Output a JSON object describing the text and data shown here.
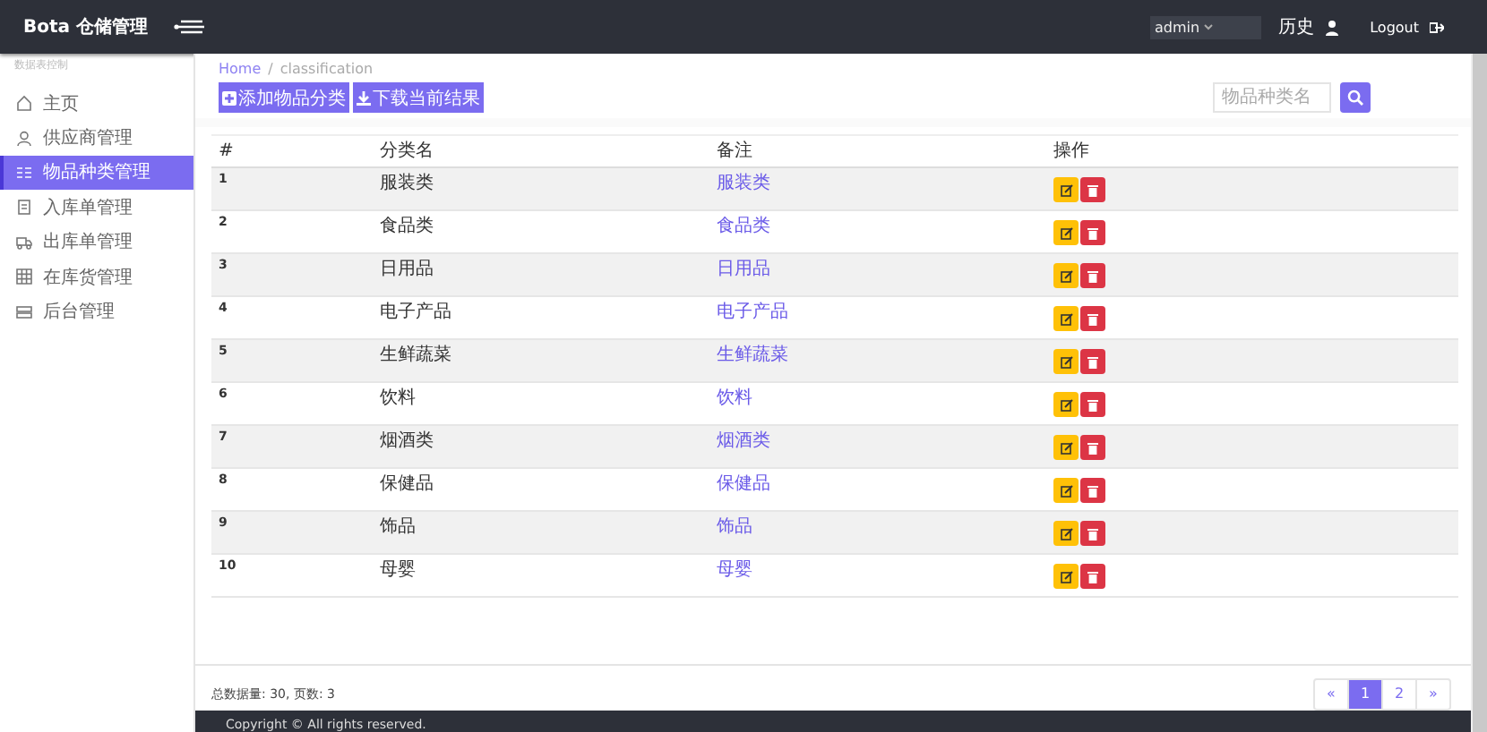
{
  "header": {
    "brand": "Bota 仓储管理",
    "user": "admin",
    "history": "历史",
    "logout": "Logout"
  },
  "sidebar": {
    "heading": "数据表控制",
    "items": [
      {
        "label": "主页",
        "selected": false
      },
      {
        "label": "供应商管理",
        "selected": false
      },
      {
        "label": "物品种类管理",
        "selected": true
      },
      {
        "label": "入库单管理",
        "selected": false
      },
      {
        "label": "出库单管理",
        "selected": false
      },
      {
        "label": "在库货管理",
        "selected": false
      },
      {
        "label": "后台管理",
        "selected": false
      }
    ]
  },
  "breadcrumb": {
    "link": "Home",
    "separator": "/",
    "current": "classification"
  },
  "toolbar": {
    "add": "添加物品分类",
    "download": "下载当前结果",
    "search": {
      "placeholder": "物品种类名"
    }
  },
  "table": {
    "columns": [
      "#",
      "分类名",
      "备注",
      "操作"
    ],
    "rows": [
      {
        "id": "1",
        "name": "服装类",
        "note": "服装类"
      },
      {
        "id": "2",
        "name": "食品类",
        "note": "食品类"
      },
      {
        "id": "3",
        "name": "日用品",
        "note": "日用品"
      },
      {
        "id": "4",
        "name": "电子产品",
        "note": "电子产品"
      },
      {
        "id": "5",
        "name": "生鲜蔬菜",
        "note": "生鲜蔬菜"
      },
      {
        "id": "6",
        "name": "饮料",
        "note": "饮料"
      },
      {
        "id": "7",
        "name": "烟酒类",
        "note": "烟酒类"
      },
      {
        "id": "8",
        "name": "保健品",
        "note": "保健品"
      },
      {
        "id": "9",
        "name": "饰品",
        "note": "饰品"
      },
      {
        "id": "10",
        "name": "母婴",
        "note": "母婴"
      }
    ]
  },
  "summary": "总数据量: 30, 页数: 3",
  "pagination": {
    "prev": "«",
    "pages": [
      {
        "label": "1",
        "selected": true
      },
      {
        "label": "2",
        "selected": false
      }
    ],
    "next": "»"
  },
  "footer": "Copyright © All rights reserved."
}
